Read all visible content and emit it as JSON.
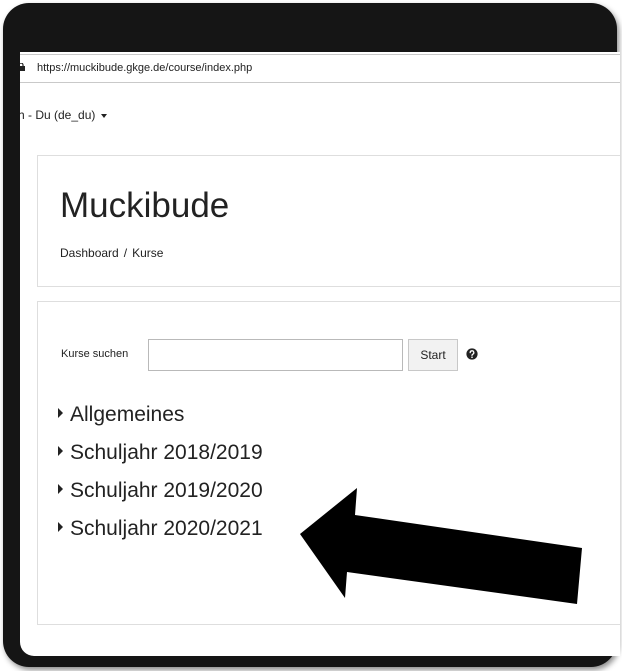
{
  "browser": {
    "url": "https://muckibude.gkge.de/course/index.php"
  },
  "language_menu": {
    "label": "h - Du (de_du)"
  },
  "header": {
    "site_title": "Muckibude",
    "breadcrumb": [
      "Dashboard",
      "Kurse"
    ],
    "breadcrumb_separator": "/"
  },
  "search": {
    "label": "Kurse suchen",
    "value": "",
    "button_label": "Start"
  },
  "categories": [
    {
      "label": "Allgemeines"
    },
    {
      "label": "Schuljahr 2018/2019"
    },
    {
      "label": "Schuljahr 2019/2020"
    },
    {
      "label": "Schuljahr 2020/2021"
    }
  ],
  "icons": {
    "lock": "lock-icon",
    "caret": "caret-down-icon",
    "help": "question-circle-icon",
    "expand": "triangle-right-icon",
    "annotation": "arrow-annotation"
  },
  "colors": {
    "frame": "#151515",
    "text": "#222222",
    "border": "#dedede",
    "button_bg": "#f2f2f2",
    "arrow": "#000000"
  }
}
